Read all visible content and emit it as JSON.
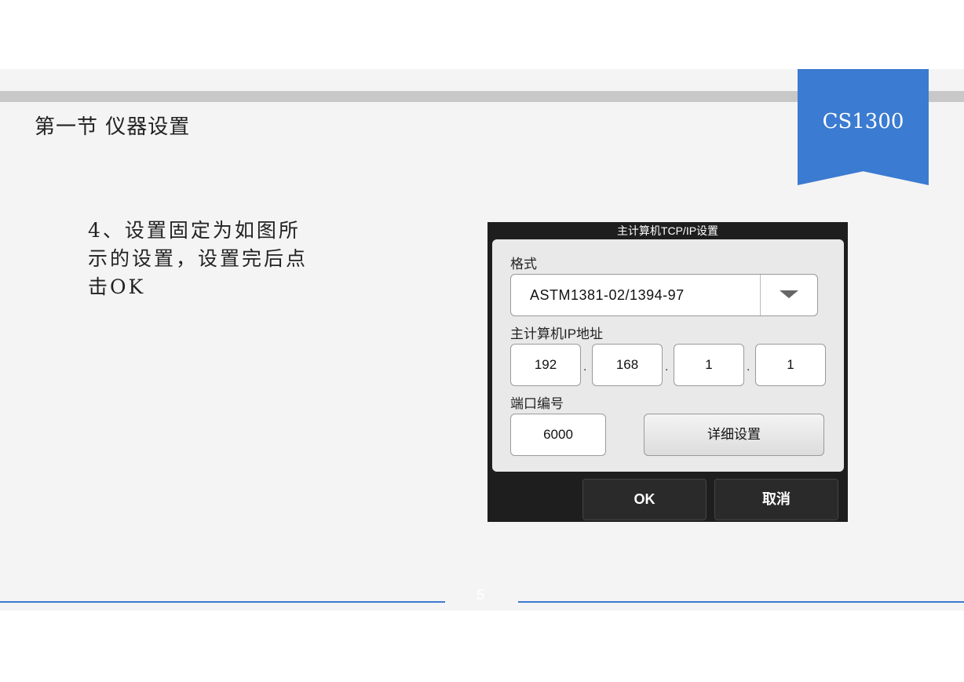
{
  "slide": {
    "section_title": "第一节 仪器设置",
    "badge": "CS1300",
    "instructions_line1": "4、设置固定为如图所",
    "instructions_line2": "示的设置，设置完后点",
    "instructions_line3": "击OK",
    "page_number": "5"
  },
  "dialog": {
    "title": "主计算机TCP/IP设置",
    "format_label": "格式",
    "format_value": "ASTM1381-02/1394-97",
    "ip_label": "主计算机IP地址",
    "ip": [
      "192",
      "168",
      "1",
      "1"
    ],
    "ip_separator": ".",
    "port_label": "端口编号",
    "port_value": "6000",
    "detail_button": "详细设置",
    "ok_button": "OK",
    "cancel_button": "取消"
  },
  "colors": {
    "accent": "#3b7bd1",
    "slide_bg": "#f4f4f4",
    "dialog_bg": "#1e1e1e"
  },
  "icons": {
    "dropdown": "chevron-down-icon"
  }
}
